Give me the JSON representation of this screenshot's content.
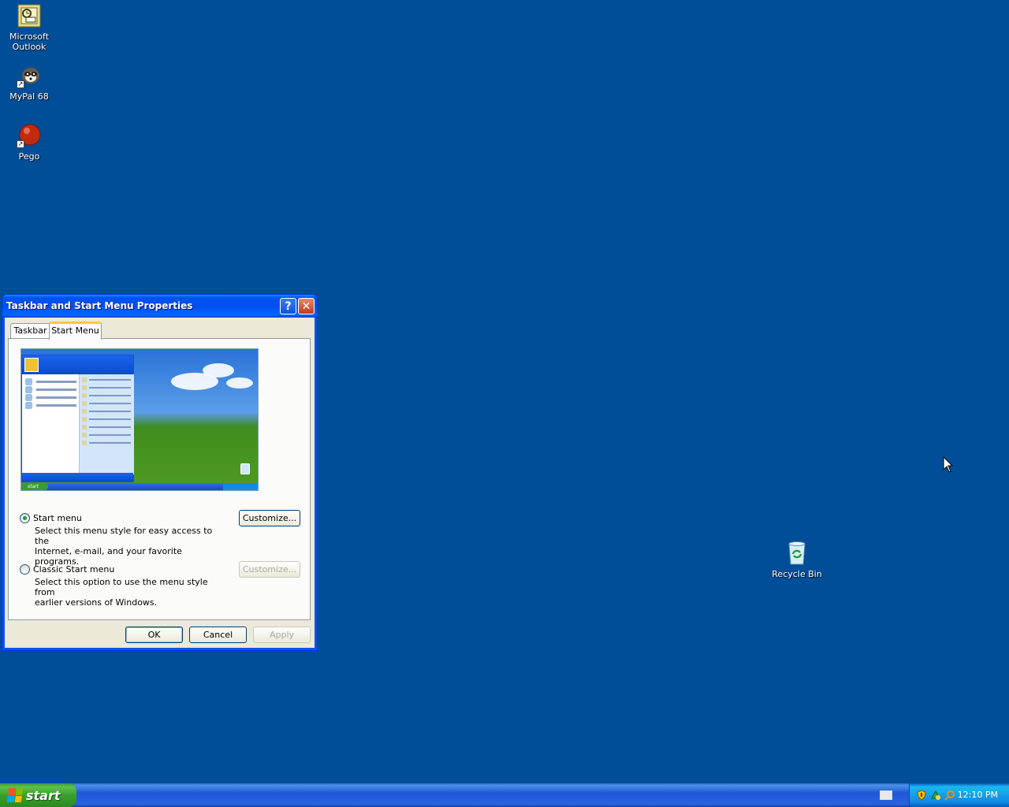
{
  "desktop": {
    "icons": [
      {
        "label_line1": "Microsoft",
        "label_line2": "Outlook",
        "icon": "outlook-icon"
      },
      {
        "label": "MyPal 68",
        "icon": "mypal-icon"
      },
      {
        "label": "Pego",
        "icon": "pego-icon"
      },
      {
        "label": "Recycle Bin",
        "icon": "recycle-bin-icon"
      }
    ]
  },
  "dialog": {
    "title": "Taskbar and Start Menu Properties",
    "help_glyph": "?",
    "close_glyph": "✕",
    "tabs": [
      {
        "label": "Taskbar",
        "active": false
      },
      {
        "label": "Start Menu",
        "active": true
      }
    ],
    "options": [
      {
        "label": "Start menu",
        "selected": true,
        "description_line1": "Select this menu style for easy access to the",
        "description_line2": "Internet, e-mail, and your favorite programs.",
        "customize_label": "Customize...",
        "customize_enabled": true
      },
      {
        "label": "Classic Start menu",
        "selected": false,
        "description_line1": "Select this option to use the menu style from",
        "description_line2": "earlier versions of Windows.",
        "customize_label": "Customize...",
        "customize_enabled": false
      }
    ],
    "buttons": {
      "ok": "OK",
      "cancel": "Cancel",
      "apply": "Apply"
    },
    "preview": {
      "start_label": "start"
    }
  },
  "taskbar": {
    "start_label": "start",
    "clock": "12:10 PM",
    "tray_icons": [
      "security-shield-icon",
      "network-icon",
      "search-icon"
    ]
  },
  "colors": {
    "desktop_bg": "#004e98",
    "titlebar": "#0053ee",
    "start_green": "#3c9a32",
    "tray_blue": "#1289e4"
  }
}
